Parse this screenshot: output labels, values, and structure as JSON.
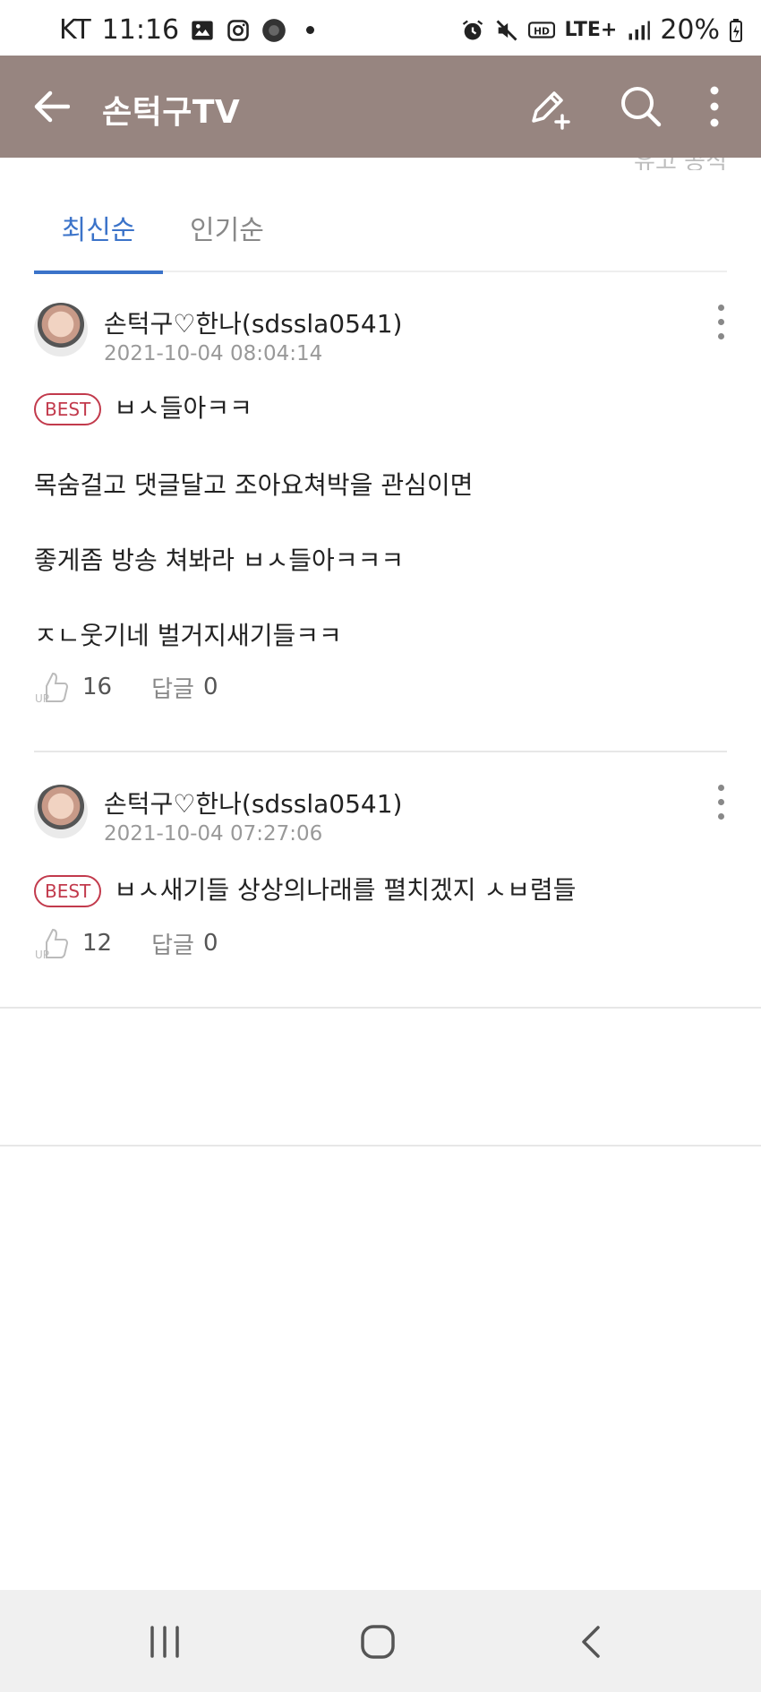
{
  "status_bar": {
    "carrier": "KT",
    "time": "11:16",
    "network": "LTE+",
    "battery": "20%"
  },
  "app_bar": {
    "title": "손턱구TV"
  },
  "strip_text": "유고 공식",
  "tabs": [
    {
      "label": "최신순",
      "active": true
    },
    {
      "label": "인기순",
      "active": false
    }
  ],
  "comments": [
    {
      "author": "손턱구♡한나(sdssla0541)",
      "date": "2021-10-04 08:04:14",
      "badge": "BEST",
      "lines": [
        "ㅂㅅ들아ㅋㅋ",
        "목숨걸고 댓글달고 조아요쳐박을 관심이면",
        "좋게좀 방송 쳐봐라 ㅂㅅ들아ㅋㅋㅋ",
        "ㅈㄴ웃기네 벌거지새기들ㅋㅋ"
      ],
      "likes": "16",
      "reply_label": "답글",
      "reply_count": "0"
    },
    {
      "author": "손턱구♡한나(sdssla0541)",
      "date": "2021-10-04 07:27:06",
      "badge": "BEST",
      "lines": [
        "ㅂㅅ새기들 상상의나래를 펼치겠지 ㅅㅂ렴들"
      ],
      "likes": "12",
      "reply_label": "답글",
      "reply_count": "0"
    }
  ],
  "colors": {
    "app_bar_bg": "#978580",
    "tab_active": "#3b73c9",
    "best_badge": "#c23a4c"
  },
  "icons": {
    "back": "arrow-left-icon",
    "write": "pencil-plus-icon",
    "search": "search-icon",
    "more": "more-vertical-icon",
    "like": "thumbs-up-icon"
  }
}
